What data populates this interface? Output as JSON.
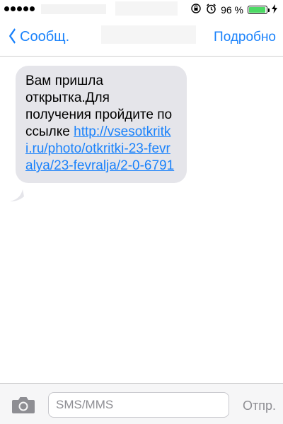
{
  "status_bar": {
    "battery_percent": "96 %",
    "battery_level": 0.96,
    "icons": [
      "signal-dots",
      "orientation-lock-icon",
      "alarm-icon",
      "battery-icon",
      "charging-bolt-icon"
    ]
  },
  "nav": {
    "back_label": "Сообщ.",
    "details_label": "Подробно"
  },
  "message": {
    "text": "Вам пришла открытка.Для получения пройдите по ссылке ",
    "link": "http://vsesotkritki.ru/photo/otkritki-23-fevralya/23-fevralja/2-0-6791"
  },
  "input_bar": {
    "placeholder": "SMS/MMS",
    "send_label": "Отпр."
  },
  "colors": {
    "accent": "#1a82fb",
    "bubble": "#e5e5ea",
    "battery": "#4cd964"
  }
}
